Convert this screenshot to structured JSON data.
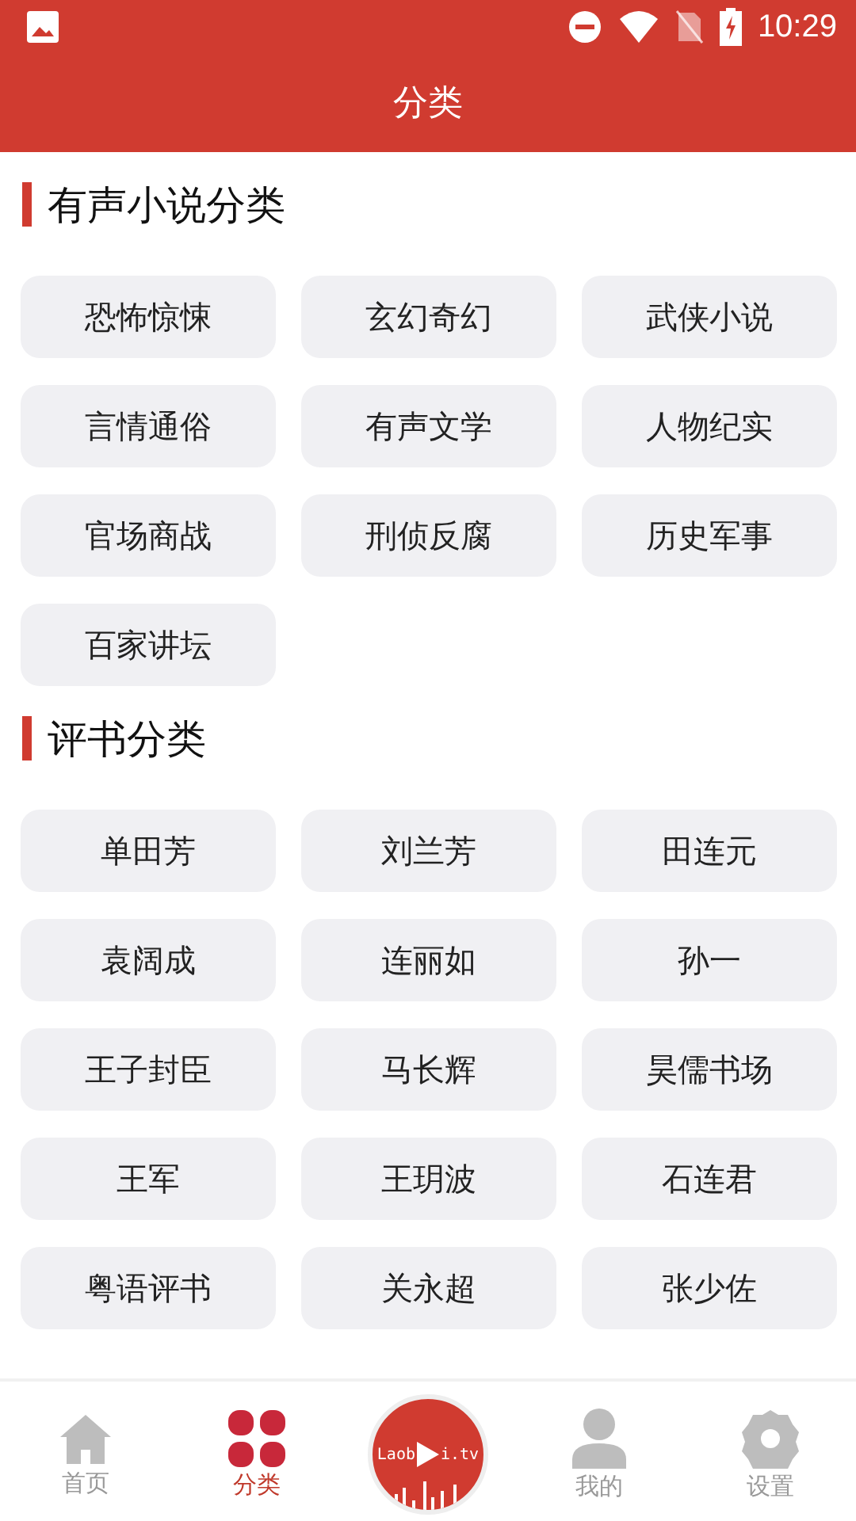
{
  "status_bar": {
    "time": "10:29"
  },
  "header": {
    "title": "分类"
  },
  "sections": [
    {
      "title": "有声小说分类",
      "items": [
        "恐怖惊悚",
        "玄幻奇幻",
        "武侠小说",
        "言情通俗",
        "有声文学",
        "人物纪实",
        "官场商战",
        "刑侦反腐",
        "历史军事",
        "百家讲坛"
      ]
    },
    {
      "title": "评书分类",
      "items": [
        "单田芳",
        "刘兰芳",
        "田连元",
        "袁阔成",
        "连丽如",
        "孙一",
        "王子封臣",
        "马长辉",
        "昊儒书场",
        "王军",
        "王玥波",
        "石连君",
        "粤语评书",
        "关永超",
        "张少佐"
      ]
    }
  ],
  "nav": [
    {
      "kind": "home",
      "label": "首页",
      "selected": false
    },
    {
      "kind": "grid",
      "label": "分类",
      "selected": true
    },
    {
      "kind": "logo",
      "text_left": "Laob",
      "text_right": "i.tv"
    },
    {
      "kind": "person",
      "label": "我的",
      "selected": false
    },
    {
      "kind": "gear",
      "label": "设置",
      "selected": false
    }
  ]
}
